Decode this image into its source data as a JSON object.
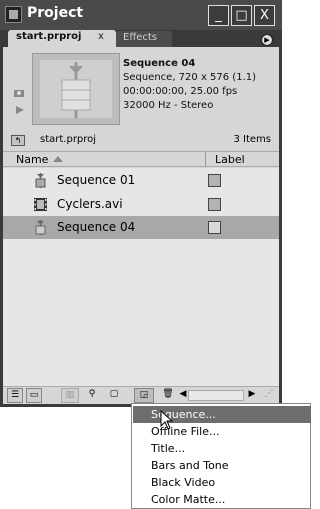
{
  "window": {
    "title": "Project",
    "buttons": [
      "_",
      "□",
      "X"
    ]
  },
  "tabs": [
    {
      "label": "start.prproj",
      "close": "x"
    },
    {
      "label": "Effects"
    }
  ],
  "panel_menu_icon": "panel-menu-icon",
  "preview": {
    "name": "Sequence 04",
    "details": [
      "Sequence, 720 x 576 (1.1)",
      "00:00:00:00, 25.00 fps",
      "32000 Hz - Stereo"
    ]
  },
  "path": {
    "project": "start.prproj",
    "count": "3 Items"
  },
  "columns": {
    "name": "Name",
    "label": "Label"
  },
  "items": [
    {
      "name": "Sequence 01",
      "icon": "sequence-icon",
      "label_color": "#b3b3b3"
    },
    {
      "name": "Cyclers.avi",
      "icon": "film-icon",
      "label_color": "#b3b3b3"
    },
    {
      "name": "Sequence 04",
      "icon": "sequence-icon",
      "label_color": "#d9d9d9",
      "selected": true
    }
  ],
  "menu": [
    {
      "label": "Sequence...",
      "highlighted": true
    },
    {
      "label": "Offline File..."
    },
    {
      "label": "Title..."
    },
    {
      "label": "Bars and Tone"
    },
    {
      "label": "Black Video"
    },
    {
      "label": "Color Matte..."
    }
  ]
}
